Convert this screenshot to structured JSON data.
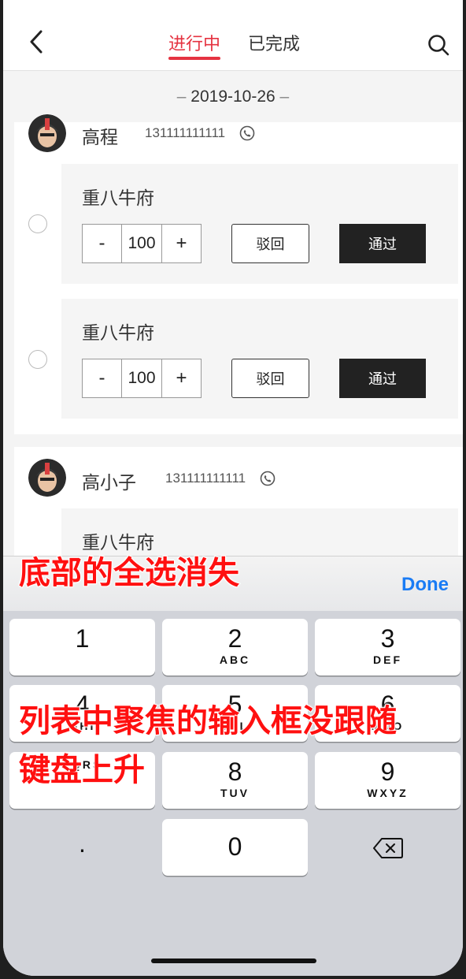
{
  "header": {
    "tabs": [
      {
        "label": "进行中",
        "active": true
      },
      {
        "label": "已完成",
        "active": false
      }
    ],
    "icons": {
      "back": "chevron-left-icon",
      "search": "search-icon"
    },
    "accent_color": "#e53341"
  },
  "date": "2019-10-26",
  "orders": [
    {
      "user_name": "高程",
      "phone": "131111111111",
      "items": [
        {
          "title": "重八牛府",
          "quantity": "100",
          "minus": "-",
          "plus": "+",
          "reject_label": "驳回",
          "pass_label": "通过"
        },
        {
          "title": "重八牛府",
          "quantity": "100",
          "minus": "-",
          "plus": "+",
          "reject_label": "驳回",
          "pass_label": "通过"
        }
      ]
    },
    {
      "user_name": "高小子",
      "phone": "131111111111",
      "items": [
        {
          "title": "重八牛府"
        }
      ]
    }
  ],
  "keyboard": {
    "done_label": "Done",
    "keys": [
      {
        "num": "1",
        "letters": ""
      },
      {
        "num": "2",
        "letters": "ABC"
      },
      {
        "num": "3",
        "letters": "DEF"
      },
      {
        "num": "4",
        "letters": "GHI"
      },
      {
        "num": "5",
        "letters": "JKL"
      },
      {
        "num": "6",
        "letters": "MNO"
      },
      {
        "num": "8",
        "letters": "TUV"
      },
      {
        "num": "9",
        "letters": "WXYZ"
      },
      {
        "num": ".",
        "letters": ""
      },
      {
        "num": "0",
        "letters": ""
      }
    ],
    "delete_icon": "backspace-icon"
  },
  "annotations": {
    "line1": "底部的全选消失",
    "line2": "列表中聚焦的输入框没跟随",
    "line3": "键盘上升"
  }
}
